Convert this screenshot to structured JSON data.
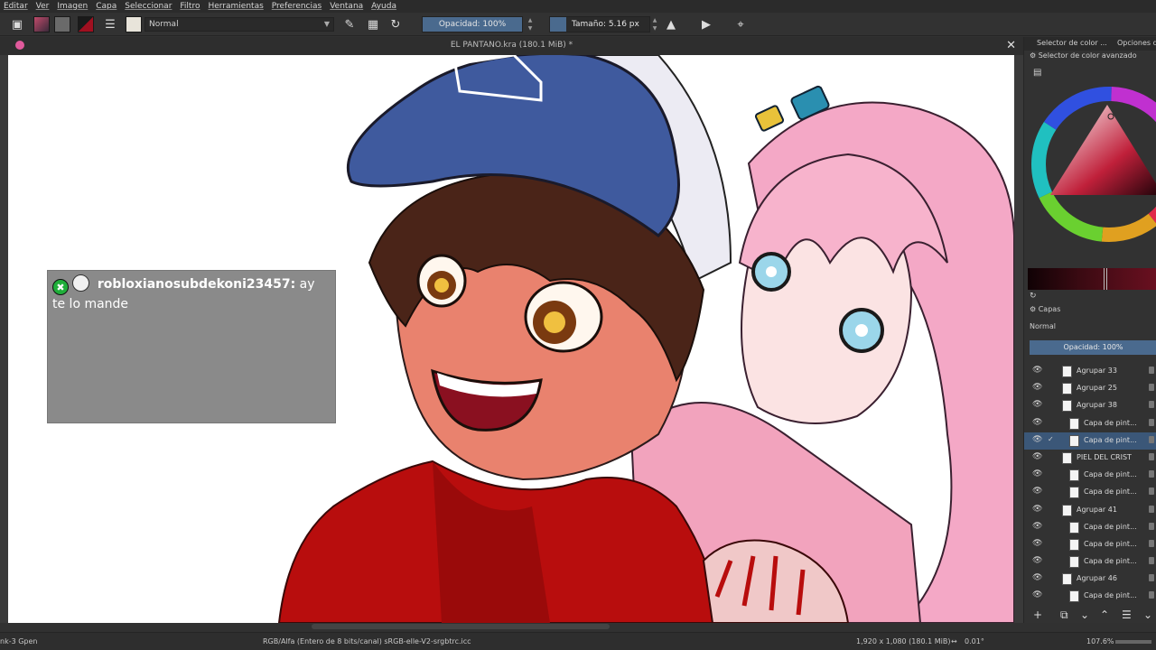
{
  "menu": [
    "Editar",
    "Ver",
    "Imagen",
    "Capa",
    "Seleccionar",
    "Filtro",
    "Herramientas",
    "Preferencias",
    "Ventana",
    "Ayuda"
  ],
  "toolbar": {
    "blend_mode": "Normal",
    "opacity_label": "Opacidad: 100%",
    "opacity_fraction": 1.0,
    "size_label": "Tamaño: 5.16 px"
  },
  "document": {
    "title": "EL PANTANO.kra (180.1 MiB) *"
  },
  "chat": {
    "username": "robloxianosubdekoni23457:",
    "message": "ay te lo mande",
    "badge_icon": "x-badge-icon"
  },
  "docker": {
    "tabs": [
      "Selector de color ...",
      "Opciones de"
    ],
    "color_selector_title": "Selector de color avanzado",
    "layers_title": "Capas",
    "layers_blend": "Normal",
    "layers_opacity": "Opacidad:  100%",
    "layers": [
      {
        "name": "Agrupar 33",
        "kind": "group",
        "indent": 0,
        "selected": false
      },
      {
        "name": "Agrupar 25",
        "kind": "group",
        "indent": 0,
        "selected": false
      },
      {
        "name": "Agrupar 38",
        "kind": "group",
        "indent": 0,
        "selected": false
      },
      {
        "name": "Capa de pint...",
        "kind": "paint",
        "indent": 1,
        "selected": false
      },
      {
        "name": "Capa de pint...",
        "kind": "paint",
        "indent": 1,
        "selected": true
      },
      {
        "name": "PIEL DEL CRIST",
        "kind": "paint",
        "indent": 0,
        "selected": false
      },
      {
        "name": "Capa de pint...",
        "kind": "paint",
        "indent": 1,
        "selected": false
      },
      {
        "name": "Capa de pint...",
        "kind": "paint",
        "indent": 1,
        "selected": false
      },
      {
        "name": "Agrupar 41",
        "kind": "group",
        "indent": 0,
        "selected": false
      },
      {
        "name": "Capa de pint...",
        "kind": "paint",
        "indent": 1,
        "selected": false
      },
      {
        "name": "Capa de pint...",
        "kind": "paint",
        "indent": 1,
        "selected": false
      },
      {
        "name": "Capa de pint...",
        "kind": "paint",
        "indent": 1,
        "selected": false
      },
      {
        "name": "Agrupar 46",
        "kind": "group",
        "indent": 0,
        "selected": false
      },
      {
        "name": "Capa de pint...",
        "kind": "paint",
        "indent": 1,
        "selected": false
      }
    ]
  },
  "status": {
    "brush": "nk-3 Gpen",
    "color_space": "RGB/Alfa (Entero de 8 bits/canal)  sRGB-elle-V2-srgbtrc.icc",
    "dimensions": "1,920 x 1,080 (180.1 MiB)",
    "rotation": "0.01°",
    "zoom": "107.6%"
  },
  "colors": {
    "accent": "#4a6a8e",
    "selected_layer": "#3b5778",
    "cap_blue": "#3f5a9e",
    "hoodie_red": "#b80d0d",
    "hair_pink": "#f4a8c6"
  }
}
